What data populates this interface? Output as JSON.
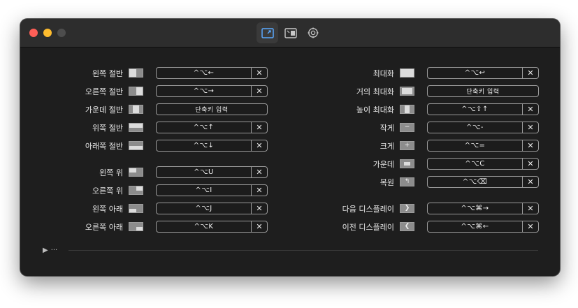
{
  "toolbar": {
    "tabs": [
      {
        "name": "shortcuts-tab-icon",
        "active": true
      },
      {
        "name": "snap-areas-tab-icon",
        "active": false
      },
      {
        "name": "settings-gear-icon",
        "active": false
      }
    ]
  },
  "left_group": [
    {
      "label": "왼쪽 절반",
      "shortcut": "^⌥←",
      "icon": "left-half-icon"
    },
    {
      "label": "오른쪽 절반",
      "shortcut": "^⌥→",
      "icon": "right-half-icon"
    },
    {
      "label": "가운데 절반",
      "shortcut": "단축키 입력",
      "icon": "center-half-icon",
      "empty": true
    },
    {
      "label": "위쪽 절반",
      "shortcut": "^⌥↑",
      "icon": "top-half-icon"
    },
    {
      "label": "아래쪽 절반",
      "shortcut": "^⌥↓",
      "icon": "bottom-half-icon"
    },
    {
      "label": "왼쪽 위",
      "shortcut": "^⌥U",
      "icon": "top-left-icon"
    },
    {
      "label": "오른쪽 위",
      "shortcut": "^⌥I",
      "icon": "top-right-icon"
    },
    {
      "label": "왼쪽 아래",
      "shortcut": "^⌥J",
      "icon": "bottom-left-icon"
    },
    {
      "label": "오른쪽 아래",
      "shortcut": "^⌥K",
      "icon": "bottom-right-icon"
    }
  ],
  "right_group": [
    {
      "label": "최대화",
      "shortcut": "^⌥↩",
      "icon": "maximize-icon"
    },
    {
      "label": "거의 최대화",
      "shortcut": "단축키 입력",
      "icon": "almost-maximize-icon",
      "empty": true
    },
    {
      "label": "높이 최대화",
      "shortcut": "^⌥⇧↑",
      "icon": "maximize-height-icon"
    },
    {
      "label": "작게",
      "shortcut": "^⌥-",
      "icon": "smaller-icon"
    },
    {
      "label": "크게",
      "shortcut": "^⌥=",
      "icon": "larger-icon"
    },
    {
      "label": "가운데",
      "shortcut": "^⌥C",
      "icon": "center-icon"
    },
    {
      "label": "복원",
      "shortcut": "^⌥⌫",
      "icon": "restore-icon"
    },
    {
      "label": "다음 디스플레이",
      "shortcut": "^⌥⌘→",
      "icon": "next-display-icon"
    },
    {
      "label": "이전 디스플레이",
      "shortcut": "^⌥⌘←",
      "icon": "previous-display-icon"
    }
  ],
  "clear_glyph": "✕",
  "disclosure": {
    "arrow": "▶",
    "label": "···"
  }
}
